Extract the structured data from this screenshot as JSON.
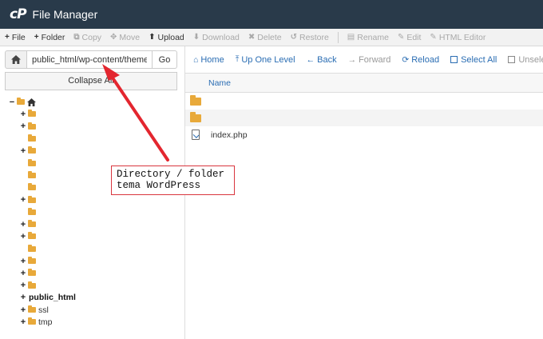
{
  "window": {
    "logo": "cP",
    "title": "File Manager"
  },
  "toolbar": {
    "items": [
      {
        "icon": "+",
        "label": "File",
        "enabled": true
      },
      {
        "icon": "+",
        "label": "Folder",
        "enabled": true
      },
      {
        "icon": "⧉",
        "label": "Copy",
        "enabled": false
      },
      {
        "icon": "✥",
        "label": "Move",
        "enabled": false
      },
      {
        "icon": "⬆",
        "label": "Upload",
        "enabled": true
      },
      {
        "icon": "⬇",
        "label": "Download",
        "enabled": false
      },
      {
        "icon": "✖",
        "label": "Delete",
        "enabled": false
      },
      {
        "icon": "↺",
        "label": "Restore",
        "enabled": false
      },
      {
        "icon": "▤",
        "label": "Rename",
        "enabled": false
      },
      {
        "icon": "✎",
        "label": "Edit",
        "enabled": false
      },
      {
        "icon": "✎",
        "label": "HTML Editor",
        "enabled": false
      }
    ]
  },
  "path": {
    "value": "public_html/wp-content/themes/",
    "go_label": "Go"
  },
  "sidebar": {
    "collapse_label": "Collapse All",
    "tree": [
      {
        "toggle": "−",
        "label": "",
        "level": 0,
        "home": true
      },
      {
        "toggle": "+",
        "label": "",
        "level": 1
      },
      {
        "toggle": "+",
        "label": "",
        "level": 1
      },
      {
        "toggle": "",
        "label": "",
        "level": 1
      },
      {
        "toggle": "+",
        "label": "",
        "level": 1
      },
      {
        "toggle": "",
        "label": "",
        "level": 1
      },
      {
        "toggle": "",
        "label": "",
        "level": 1
      },
      {
        "toggle": "",
        "label": "",
        "level": 1
      },
      {
        "toggle": "+",
        "label": "",
        "level": 1
      },
      {
        "toggle": "",
        "label": "",
        "level": 1
      },
      {
        "toggle": "+",
        "label": "",
        "level": 1
      },
      {
        "toggle": "+",
        "label": "",
        "level": 1
      },
      {
        "toggle": "",
        "label": "",
        "level": 1
      },
      {
        "toggle": "+",
        "label": "",
        "level": 1
      },
      {
        "toggle": "+",
        "label": "",
        "level": 1
      },
      {
        "toggle": "+",
        "label": "",
        "level": 1
      },
      {
        "toggle": "+",
        "label": "public_html",
        "level": 1,
        "bold": true,
        "noicon": true
      },
      {
        "toggle": "+",
        "label": "ssl",
        "level": 1
      },
      {
        "toggle": "+",
        "label": "tmp",
        "level": 1
      }
    ]
  },
  "navbar": {
    "items": [
      {
        "icon": "⌂",
        "label": "Home",
        "enabled": true
      },
      {
        "icon": "⤒",
        "label": "Up One Level",
        "enabled": true
      },
      {
        "icon": "←",
        "label": "Back",
        "enabled": true
      },
      {
        "icon": "→",
        "label": "Forward",
        "enabled": false
      },
      {
        "icon": "⟳",
        "label": "Reload",
        "enabled": true
      },
      {
        "icon": "chk",
        "label": "Select All",
        "enabled": true
      },
      {
        "icon": "chk",
        "label": "Unselect All",
        "enabled": false
      }
    ]
  },
  "file_list": {
    "column_name": "Name",
    "rows": [
      {
        "type": "folder",
        "name": ""
      },
      {
        "type": "folder",
        "name": ""
      },
      {
        "type": "file",
        "name": "index.php"
      }
    ]
  },
  "annotation": {
    "line1": "Directory / folder",
    "line2": "tema WordPress"
  },
  "colors": {
    "titlebar": "#293a4a",
    "link": "#2a6db3",
    "folder": "#e8a93a",
    "annotation": "#d9363e"
  }
}
